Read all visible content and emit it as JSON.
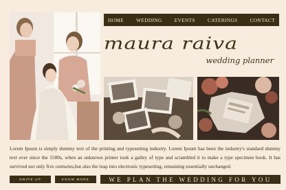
{
  "nav": {
    "items": [
      {
        "label": "HOME"
      },
      {
        "label": "WEDDING"
      },
      {
        "label": "EVENTS"
      },
      {
        "label": "CATERINGS"
      },
      {
        "label": "CONTACT"
      }
    ]
  },
  "brand": {
    "name": "maura raiva",
    "subtitle": "wedding planner"
  },
  "intro": {
    "text": "Lorem Ipsum is simply dummy text of the printing and typesetting industry. Lorem Ipsum has been the industry's standard dummy text ever since the 1500s, when an unknown printer took a galley of type and scrambled it to make a type specimen book. It has survived not only five centuries,but also the leap into electronic typesetting,  remaining essentially unchanged."
  },
  "buttons": {
    "swipe_up": "SWIPE UP",
    "know_more": "KNOW MORE"
  },
  "tagline": "WE PLAN THE WEDDING FOR YOU",
  "colors": {
    "background": "#f7ecde",
    "accent_dark": "#3a2f16",
    "text_light": "#f3e8d6"
  }
}
